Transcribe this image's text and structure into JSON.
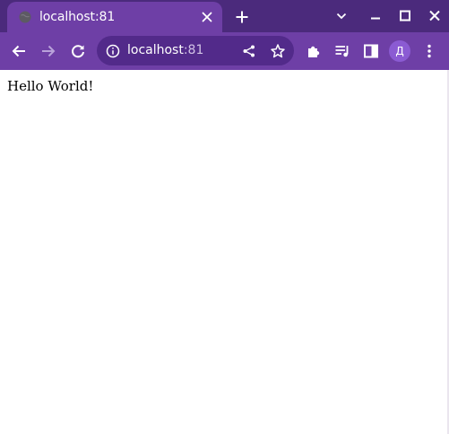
{
  "tab": {
    "title": "localhost:81",
    "favicon": "globe-icon",
    "close_icon": "close-icon"
  },
  "new_tab_icon": "plus-icon",
  "window_controls": [
    "chevron-down-icon",
    "minimize-icon",
    "maximize-icon",
    "close-icon"
  ],
  "omnibox": {
    "host": "localhost",
    "port": ":81",
    "icon": "info-icon"
  },
  "toolbar_icons": [
    "back-icon",
    "forward-icon",
    "reload-icon",
    "share-icon",
    "star-icon",
    "extensions-icon",
    "media-icon",
    "side-panel-icon",
    "menu-icon"
  ],
  "profile": {
    "initial": "Д"
  },
  "page": {
    "text": "Hello World!"
  },
  "colors": {
    "titlebar": "#4b2a7c",
    "toolbar": "#6e3fa6",
    "omnibox": "#522a8a",
    "avatar": "#8b5bd3"
  }
}
